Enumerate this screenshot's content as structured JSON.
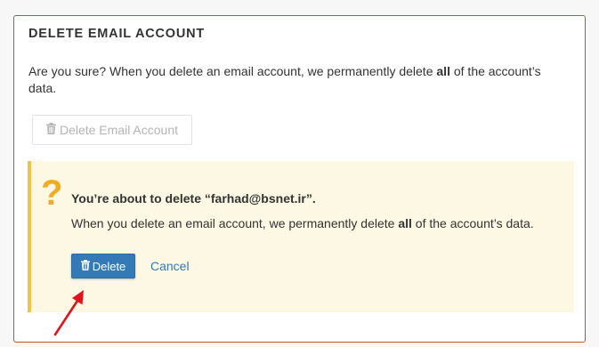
{
  "panel": {
    "title": "DELETE EMAIL ACCOUNT",
    "confirm_pre": "Are you sure? When you delete an email account, we permanently delete ",
    "confirm_bold": "all",
    "confirm_post": " of the account’s data.",
    "disabled_button_label": "Delete Email Account",
    "border_color": "#c0561c"
  },
  "warning": {
    "icon": "question-icon",
    "icon_glyph": "?",
    "title": "You’re about to delete “farhad@bsnet.ir”.",
    "text_pre": "When you delete an email account, we permanently delete ",
    "text_bold": "all",
    "text_post": " of the account’s data.",
    "delete_label": "Delete",
    "cancel_label": "Cancel",
    "background_color": "#fcf8e3",
    "accent_color": "#f0c547"
  },
  "annotation": {
    "icon": "red-arrow-icon",
    "color": "#e0141a"
  },
  "colors": {
    "primary": "#337ab7"
  }
}
